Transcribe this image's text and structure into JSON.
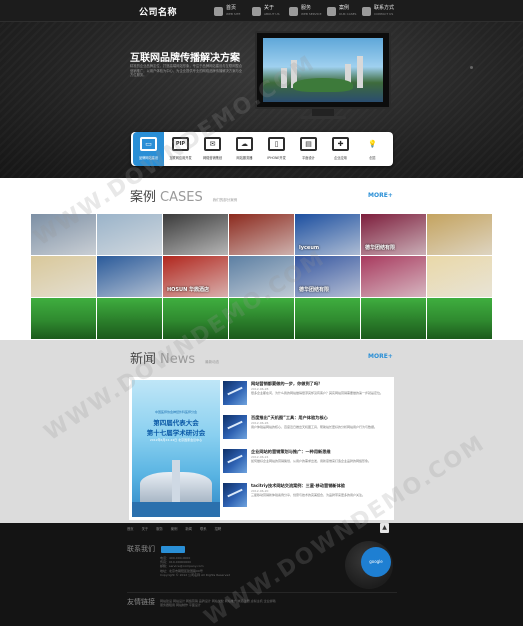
{
  "header": {
    "logo": "公司名称",
    "nav": [
      {
        "title": "首页",
        "sub": "WEB SITE"
      },
      {
        "title": "关于",
        "sub": "ABOUT US"
      },
      {
        "title": "服务",
        "sub": "WEB SERVICE"
      },
      {
        "title": "案例",
        "sub": "OUR CASES"
      },
      {
        "title": "联系方式",
        "sub": "CONTACT US"
      }
    ]
  },
  "hero": {
    "title": "互联网品牌传播解决方案",
    "desc": "精准的企业品牌定位，打造高端网站形象，专注于品牌网站建设与互联网整合营销推广，以用户体验为中心，为企业提供专业的网络品牌传播解决方案与全方位服务。"
  },
  "services": [
    {
      "label": "品牌网站建设",
      "icon": "monitor-icon",
      "glyph": "▭",
      "active": true
    },
    {
      "label": "互联网应用开发",
      "icon": "pip-icon",
      "glyph": "PIP",
      "active": false
    },
    {
      "label": "网络营销策划",
      "icon": "chat-icon",
      "glyph": "✉",
      "active": false
    },
    {
      "label": "网站服务器",
      "icon": "cloud-icon",
      "glyph": "☁",
      "active": false
    },
    {
      "label": "IPHONE开发",
      "icon": "phone-icon",
      "glyph": "▯",
      "active": false
    },
    {
      "label": "平面设计",
      "icon": "card-icon",
      "glyph": "▤",
      "active": false
    },
    {
      "label": "企业应用",
      "icon": "plus-grid-icon",
      "glyph": "✚",
      "active": false
    },
    {
      "label": "创意",
      "icon": "bulb-icon",
      "glyph": "💡",
      "active": false
    }
  ],
  "cases": {
    "title_cn": "案例",
    "title_en": "CASES",
    "subtitle": "我们的部分案例",
    "more": "MORE+",
    "tiles": [
      {
        "label": ""
      },
      {
        "label": ""
      },
      {
        "label": ""
      },
      {
        "label": ""
      },
      {
        "label": "lyceum"
      },
      {
        "label": "德华团结有限"
      },
      {
        "label": ""
      },
      {
        "label": ""
      },
      {
        "label": ""
      },
      {
        "label": "HOSUN 华鼎酒店"
      },
      {
        "label": ""
      },
      {
        "label": "德华团结有限"
      },
      {
        "label": ""
      },
      {
        "label": ""
      },
      {
        "label": ""
      },
      {
        "label": ""
      },
      {
        "label": ""
      },
      {
        "label": ""
      },
      {
        "label": ""
      },
      {
        "label": ""
      },
      {
        "label": ""
      }
    ],
    "colors": [
      "#7c8fa4",
      "#9ab3c9",
      "#3a3a3a",
      "#8c2a1e",
      "#1c4fa0",
      "#7d1e3c",
      "#c4a35f",
      "#d9c89a",
      "#2a5a9a",
      "#b1261d",
      "#5c7fa3",
      "#3556a0",
      "#a83a5e",
      "#e9d8a8",
      "#2f8a2f",
      "#2b7f2b",
      "#2f8a2f",
      "#2b7f2b",
      "#2f8a2f",
      "#2b7f2b",
      "#2f8a2f"
    ]
  },
  "news": {
    "title_cn": "新闻",
    "title_en": "News",
    "subtitle": "最新动态",
    "more": "MORE+",
    "poster": {
      "line1": "中国医师协会神经外科医师分会",
      "line2": "第四届代表大会",
      "line3": "第十七届学术研讨会",
      "line4": "2012年6月22-24日 北京国家会议中心"
    },
    "items": [
      {
        "title": "网站营销都要做的一步，你做到了吗？",
        "date": "2012-06-28",
        "summary": "很多企业都在问，为什么我的网站做得很漂亮却没有客户？其实网站营销需要做的第一步就是定位。"
      },
      {
        "title": "百度推出“天机图”工具：用户体验为核心",
        "date": "2012-06-26",
        "summary": "用户体验是网站的核心，百度近日推出天机图工具，帮助站长更好的分析网站用户行为与数据。"
      },
      {
        "title": "企业网站的营销策划与推广：一种用新思维",
        "date": "2012-06-24",
        "summary": "如何做好企业网站的营销策划，从用户的需求出发，用新思维来打造企业品牌的网络形象。"
      },
      {
        "title": "tacitriy技术网站交流案例：三星·移动营销新体验",
        "date": "2012-06-20",
        "summary": "三星移动营销新体验案例分享，创意与技术的完美结合，为品牌带来更多的用户关注。"
      }
    ]
  },
  "footer": {
    "links": [
      "首页",
      "关于",
      "服务",
      "案例",
      "新闻",
      "联系",
      "招聘"
    ],
    "contact_title": "联系我们",
    "contact_lines": [
      "电话：400-000-0000",
      "传真：010-00000000",
      "邮箱：service@company.com",
      "地址：北京市朝阳区建国路00号",
      "Copyright © 2012 公司名称 All Rights Reserved"
    ],
    "map_label": "google",
    "links_title": "友情链接",
    "friend_lines": [
      "网站建设  网站设计  网络营销  品牌设计  网站优化  网站推广  域名注册  虚拟主机  企业邮箱",
      "服务器租用  网站制作  平面设计"
    ],
    "top_btn": "▲"
  },
  "watermark": "WWW.DOWNDEMO.COM"
}
